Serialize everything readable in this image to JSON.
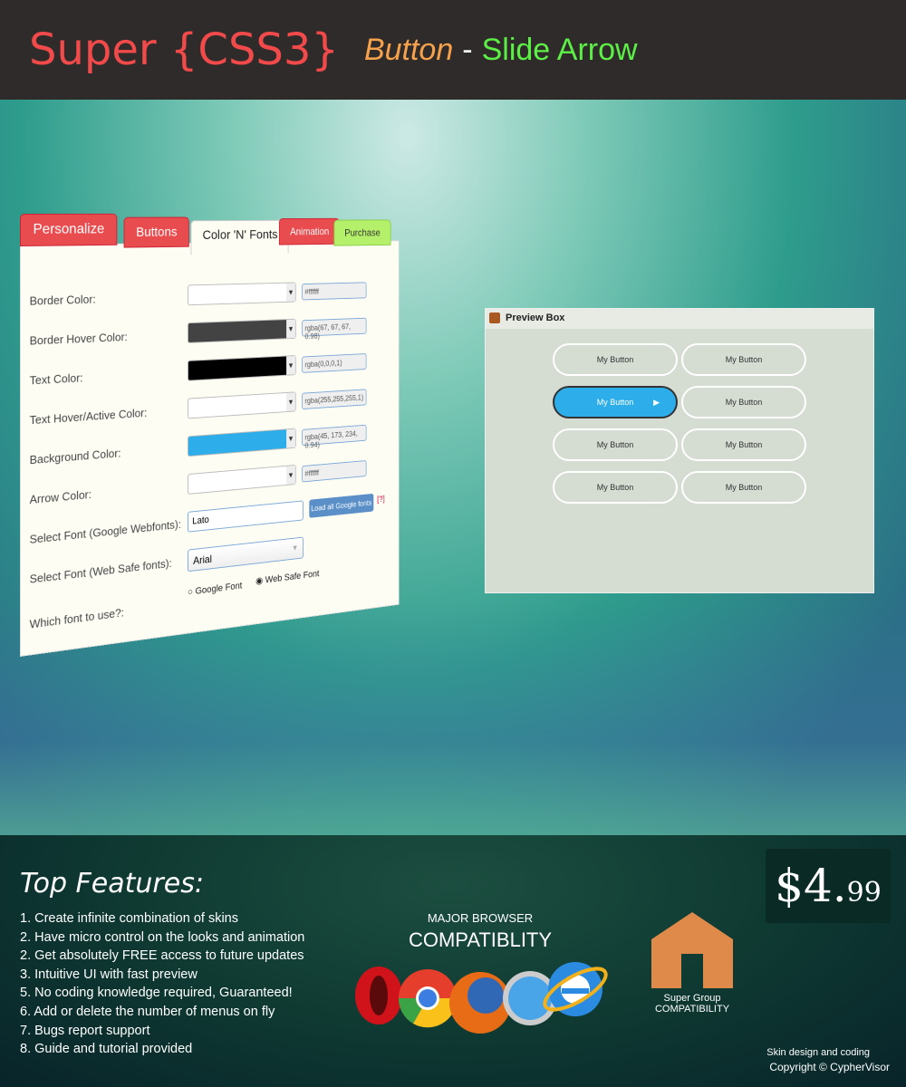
{
  "header": {
    "title_brand": "Super {CSS3}",
    "title_button": "Button",
    "title_sep": "-",
    "title_sub": "Slide Arrow"
  },
  "panel": {
    "tabs": [
      {
        "label": "Personalize",
        "color": "#e84c4f"
      },
      {
        "label": "Buttons",
        "color": "#e84c4f"
      },
      {
        "label": "Color 'N' Fonts",
        "color": "#fdfdf4",
        "active": true
      },
      {
        "label": "Animation",
        "color": "#e84c4f"
      },
      {
        "label": "Purchase",
        "color": "#b4f06a"
      }
    ],
    "colors": [
      {
        "label": "Border Color:",
        "swatch": "#ffffff",
        "value": "#ffffff"
      },
      {
        "label": "Border Hover Color:",
        "swatch": "#434343",
        "value": "rgba(67, 67, 67, 0.98)"
      },
      {
        "label": "Text Color:",
        "swatch": "#000000",
        "value": "rgba(0,0,0,1)"
      },
      {
        "label": "Text Hover/Active Color:",
        "swatch": "#ffffff",
        "value": "rgba(255,255,255,1)"
      },
      {
        "label": "Background Color:",
        "swatch": "#2dadea",
        "value": "rgba(45, 173, 234, 0.94)"
      },
      {
        "label": "Arrow Color:",
        "swatch": "#ffffff",
        "value": "#ffffff"
      }
    ],
    "google_font_label": "Select Font (Google Webfonts):",
    "google_font_value": "Lato",
    "load_fonts_button": "Load all Google fonts",
    "help_link": "[?]",
    "websafe_label": "Select Font (Web Safe fonts):",
    "websafe_value": "Arial",
    "which_label": "Which font to use?:",
    "radio_google": "Google Font",
    "radio_websafe": "Web Safe Font",
    "selected": "Web Safe Font"
  },
  "preview": {
    "title": "Preview Box",
    "buttons": [
      "My Button",
      "My Button",
      "My Button",
      "My Button",
      "My Button",
      "My Button",
      "My Button",
      "My Button"
    ],
    "active_index": 2
  },
  "features": {
    "title": "Top Features:",
    "items": [
      "1. Create infinite combination of skins",
      "2. Have micro control on the looks and animation",
      "2. Get absolutely FREE access to future updates",
      "3. Intuitive UI with fast preview",
      "5. No coding knowledge required, Guaranteed!",
      "6. Add or delete the number of menus on fly",
      "7. Bugs report support",
      "8. Guide and tutorial provided"
    ]
  },
  "compat": {
    "line1": "MAJOR BROWSER",
    "line2": "COMPATIBLITY",
    "browsers": [
      "opera",
      "chrome",
      "firefox",
      "safari",
      "internet-explorer"
    ]
  },
  "group": {
    "line1": "Super Group",
    "line2": "COMPATIBILITY",
    "color": "#df8a4a"
  },
  "price": {
    "dollars": "$4.",
    "cents": "99"
  },
  "credit": {
    "line1": "Skin design and coding",
    "line2": "Copyright © CypherVisor"
  }
}
